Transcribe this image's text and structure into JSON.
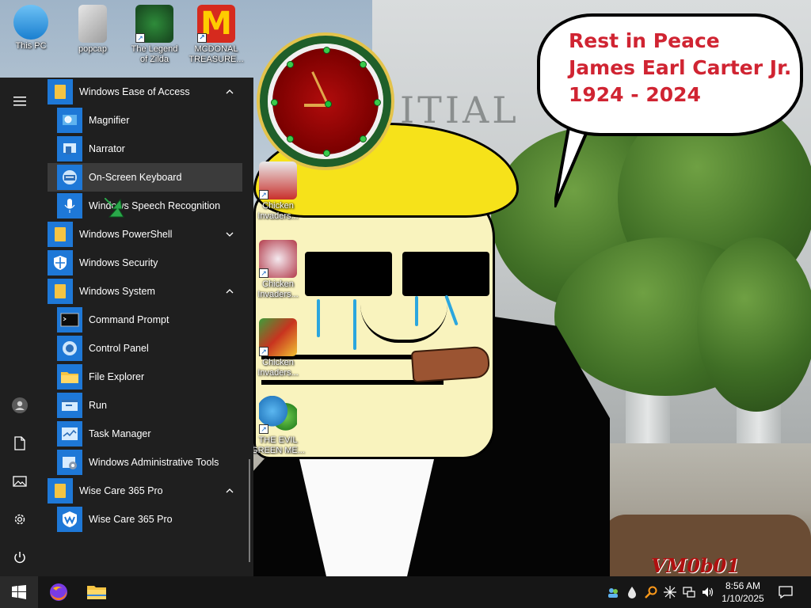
{
  "desktop": {
    "icons_top": [
      {
        "name": "this-pc",
        "label_line1": "This PC",
        "label_line2": ""
      },
      {
        "name": "popcap",
        "label_line1": "popcap",
        "label_line2": ""
      },
      {
        "name": "the-legend-of-zilda",
        "label_line1": "The Legend",
        "label_line2": "of Zilda"
      },
      {
        "name": "mcdonal-treasure",
        "label_line1": "MCDONAL",
        "label_line2": "TREASURE..."
      }
    ],
    "icons_side": [
      {
        "name": "chicken-invaders-1",
        "label_line1": "Chicken",
        "label_line2": "Invaders..."
      },
      {
        "name": "chicken-invaders-2",
        "label_line1": "Chicken",
        "label_line2": "Invaders..."
      },
      {
        "name": "chicken-invaders-3",
        "label_line1": "Chicken",
        "label_line2": "Invaders..."
      },
      {
        "name": "the-evil-green-me",
        "label_line1": "THE EVIL",
        "label_line2": "GREEN ME..."
      }
    ],
    "wallpaper_letters": "ITIAL",
    "speech_bubble": {
      "line1": "Rest in Peace",
      "line2": "James Earl Carter Jr.",
      "line3": "1924 - 2024",
      "text_color": "#d02432"
    },
    "watermark": "VM0b01"
  },
  "start_menu": {
    "rail": [
      "hamburger-icon",
      "user-avatar-icon",
      "documents-icon",
      "pictures-icon",
      "settings-icon",
      "power-icon"
    ],
    "apps": [
      {
        "label": "Windows Ease of Access",
        "type": "folder",
        "expanded": true
      },
      {
        "label": "Magnifier",
        "type": "app",
        "icon": "magnifier-icon"
      },
      {
        "label": "Narrator",
        "type": "app",
        "icon": "narrator-icon"
      },
      {
        "label": "On-Screen Keyboard",
        "type": "app",
        "icon": "keyboard-icon",
        "hover": true
      },
      {
        "label": "Windows Speech Recognition",
        "type": "app",
        "icon": "microphone-icon"
      },
      {
        "label": "Windows PowerShell",
        "type": "folder",
        "expanded": false
      },
      {
        "label": "Windows Security",
        "type": "app",
        "icon": "shield-icon"
      },
      {
        "label": "Windows System",
        "type": "folder",
        "expanded": true
      },
      {
        "label": "Command Prompt",
        "type": "app",
        "icon": "cmd-icon"
      },
      {
        "label": "Control Panel",
        "type": "app",
        "icon": "control-panel-icon"
      },
      {
        "label": "File Explorer",
        "type": "app",
        "icon": "folder-icon"
      },
      {
        "label": "Run",
        "type": "app",
        "icon": "run-icon"
      },
      {
        "label": "Task Manager",
        "type": "app",
        "icon": "task-manager-icon"
      },
      {
        "label": "Windows Administrative Tools",
        "type": "app",
        "icon": "admin-tools-icon"
      },
      {
        "label": "Wise Care 365 Pro",
        "type": "folder",
        "expanded": true
      },
      {
        "label": "Wise Care 365 Pro",
        "type": "app",
        "icon": "wise-care-icon"
      }
    ]
  },
  "taskbar": {
    "pinned": [
      "windows-start-icon",
      "firefox-icon",
      "file-explorer-icon"
    ],
    "tray": [
      "people-icon",
      "droplet-icon",
      "search-magnifier-icon",
      "sparkle-icon",
      "network-icon",
      "volume-icon"
    ],
    "time": "8:56 AM",
    "date": "1/10/2025",
    "accent": "#1e78d7"
  }
}
